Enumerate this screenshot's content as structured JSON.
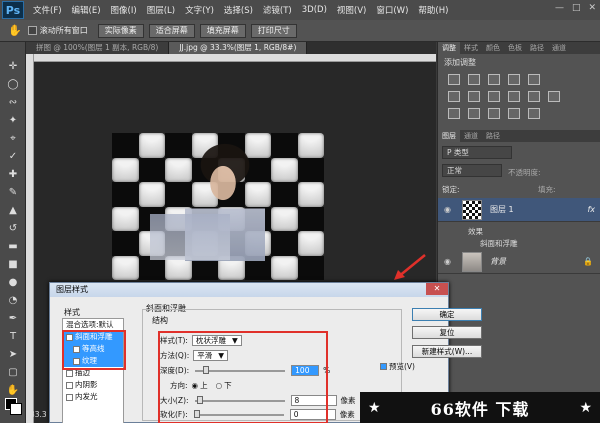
{
  "app": {
    "logo": "Ps",
    "menu": [
      "文件(F)",
      "编辑(E)",
      "图像(I)",
      "图层(L)",
      "文字(Y)",
      "选择(S)",
      "滤镜(T)",
      "3D(D)",
      "视图(V)",
      "窗口(W)",
      "帮助(H)"
    ]
  },
  "options": {
    "scroll_all": "滚动所有窗口",
    "buttons": [
      "实际像素",
      "适合屏幕",
      "填充屏幕",
      "打印尺寸"
    ]
  },
  "tabs": [
    "拼图 @ 100%(图层 1 副本, RGB/8)",
    "JJ.jpg @ 33.3%(图层 1, RGB/8#)"
  ],
  "adjust_panel": {
    "tabs": [
      "调整",
      "样式",
      "颜色",
      "色板",
      "路径",
      "通道"
    ],
    "title": "添加调整"
  },
  "layers_panel": {
    "tabs": [
      "图层",
      "通道",
      "路径"
    ],
    "filter": "P 类型",
    "blend": "正常",
    "opacity_label": "不透明度:",
    "lock_label": "锁定:",
    "fill_label": "填充:",
    "layers": [
      {
        "name": "图层 1",
        "fx": "fx"
      },
      {
        "name": "背景"
      }
    ],
    "effects_label": "效果",
    "effect_item": "斜面和浮雕"
  },
  "dialog": {
    "title": "图层样式",
    "styles_header": "样式",
    "blend_options": "混合选项:默认",
    "style_items": [
      "斜面和浮雕",
      "等高线",
      "纹理",
      "描边",
      "内阴影",
      "内发光"
    ],
    "group_title": "斜面和浮雕",
    "structure": "结构",
    "fields": {
      "style_label": "样式(T):",
      "style_value": "枕状浮雕",
      "method_label": "方法(Q):",
      "method_value": "平滑",
      "depth_label": "深度(D):",
      "depth_value": "100",
      "depth_unit": "%",
      "direction_label": "方向:",
      "dir_up": "上",
      "dir_down": "下",
      "size_label": "大小(Z):",
      "size_value": "8",
      "size_unit": "像素",
      "soften_label": "软化(F):",
      "soften_value": "0",
      "soften_unit": "像素"
    },
    "buttons": {
      "ok": "确定",
      "reset": "复位",
      "new_style": "新建样式(W)...",
      "preview": "预览(V)"
    }
  },
  "status": {
    "zoom": "33.3"
  },
  "watermark": {
    "star": "★",
    "text": "66软件 下载"
  }
}
